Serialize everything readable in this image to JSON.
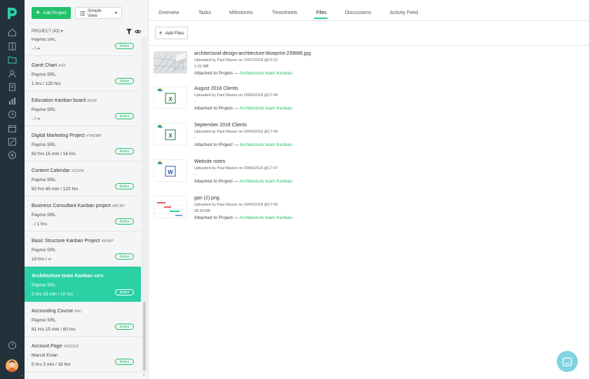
{
  "toolbar": {
    "add_project_label": "Add Project",
    "view_label": "Simple View"
  },
  "list_header": {
    "count_label": "PROJECT (43)"
  },
  "projects": [
    {
      "name": "",
      "code": "",
      "client": "Paymo SRL",
      "hours": "- / ∞",
      "status": "Active",
      "active": false
    },
    {
      "name": "Gantt Chart",
      "code": "#GC",
      "client": "Paymo SRL",
      "hours": "1 hrs / 120 hrs",
      "status": "Active",
      "active": false
    },
    {
      "name": "Education Kanban board",
      "code": "#EKB",
      "client": "Paymo SRL",
      "hours": "- / ∞",
      "status": "Active",
      "active": false
    },
    {
      "name": "Digital Marketing Project",
      "code": "#TADMP",
      "client": "Paymo SRL",
      "hours": "62 hrs 15 min / 16 hrs",
      "status": "Active",
      "active": false
    },
    {
      "name": "Content Calendar",
      "code": "#CEPA",
      "client": "Paymo SRL",
      "hours": "82 hrs 45 min / 120 hrs",
      "status": "Active",
      "active": false
    },
    {
      "name": "Business Consultant Kanban project",
      "code": "#BCKP",
      "client": "Paymo SRL",
      "hours": "- / 1 hrs",
      "status": "Active",
      "active": false
    },
    {
      "name": "Basic Structure Kanban Project",
      "code": "#BSKP",
      "client": "Paymo SRL",
      "hours": "10 hrs / ∞",
      "status": "Active",
      "active": false
    },
    {
      "name": "Architecture team Kanban",
      "code": "#ATK",
      "client": "Paymo SRL",
      "hours": "5 hrs 15 min / 10 hrs",
      "status": "Active",
      "active": true
    },
    {
      "name": "Accounting Course",
      "code": "#AC",
      "client": "Paymo SRL",
      "hours": "81 hrs 15 min / 60 hrs",
      "status": "Active",
      "active": false
    },
    {
      "name": "Account Page",
      "code": "#802163",
      "client": "Marcel Evian",
      "hours": "5 hrs 3 min / 16 hrs",
      "status": "Active",
      "active": false
    }
  ],
  "tabs": [
    {
      "label": "Overview"
    },
    {
      "label": "Tasks"
    },
    {
      "label": "Milestones"
    },
    {
      "label": "Timesheets"
    },
    {
      "label": "Files"
    },
    {
      "label": "Discussions"
    },
    {
      "label": "Activity Feed"
    }
  ],
  "selected_tab": "Files",
  "files_toolbar": {
    "add_files_label": "Add Files"
  },
  "attached_prefix": "Attached to Project —",
  "files": [
    {
      "name": "architectural-design-architecture-blueprint-239886.jpg",
      "uploaded": "Uploaded by Paul Mason on 16/07/2018 @12:12",
      "size": "1.91 MB",
      "project": "Architecture team Kanban",
      "kind": "image-blueprint"
    },
    {
      "name": "August 2018 Clients",
      "uploaded": "Uploaded by Paul Mason on 29/06/2018 @17:49",
      "size": "-",
      "project": "Architecture team Kanban",
      "kind": "sheet"
    },
    {
      "name": "September 2018 Clients",
      "uploaded": "Uploaded by Paul Mason on 29/06/2018 @17:49",
      "size": "-",
      "project": "Architecture team Kanban",
      "kind": "sheet"
    },
    {
      "name": "Website notes",
      "uploaded": "Uploaded by Paul Mason on 29/06/2018 @17:47",
      "size": "-",
      "project": "Architecture team Kanban",
      "kind": "doc"
    },
    {
      "name": "gan (2).png",
      "uploaded": "Uploaded by Paul Mason on 29/06/2018 @17:43",
      "size": "29.33 KB",
      "project": "Architecture team Kanban",
      "kind": "image-gantt"
    }
  ],
  "colors": {
    "rail": "#23313a",
    "accent": "#23c16b",
    "selected_row": "#2bd0a4"
  }
}
